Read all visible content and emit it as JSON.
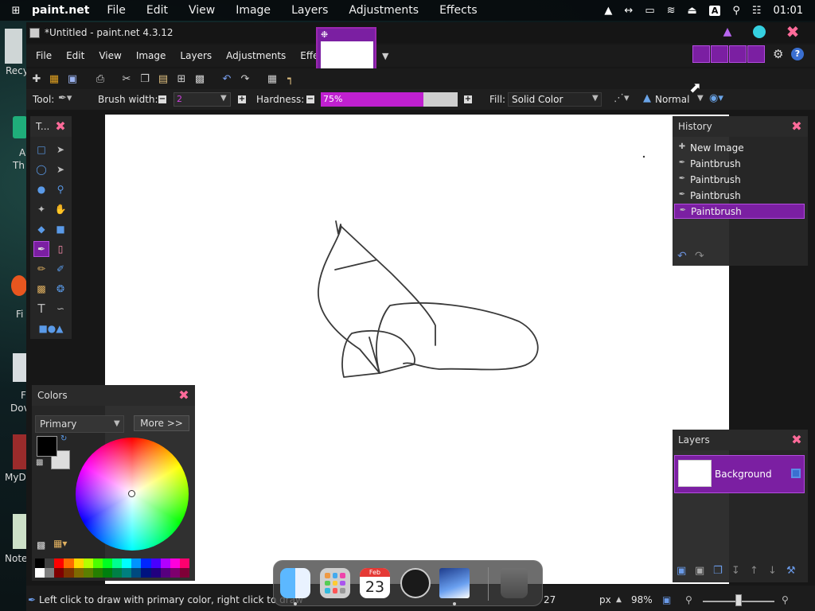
{
  "os_menubar": {
    "app_name": "paint.net",
    "menus": [
      "File",
      "Edit",
      "View",
      "Image",
      "Layers",
      "Adjustments",
      "Effects"
    ],
    "clock": "01:01",
    "input_indicator": "A"
  },
  "desktop_labels": [
    "Recy",
    "A",
    "Th",
    "Fi",
    "F",
    "Dov",
    "MyD",
    "Note"
  ],
  "window": {
    "title": "*Untitled - paint.net 4.3.12",
    "menus": [
      "File",
      "Edit",
      "View",
      "Image",
      "Layers",
      "Adjustments",
      "Effects"
    ]
  },
  "toolbar": {
    "tool_label": "Tool:",
    "brush_width_label": "Brush width:",
    "brush_width_value": "2",
    "hardness_label": "Hardness:",
    "hardness_value": "75%",
    "hardness_fraction": 0.75,
    "fill_label": "Fill:",
    "fill_value": "Solid Color",
    "blend_mode": "Normal"
  },
  "tools_panel": {
    "title": "T..."
  },
  "history": {
    "title": "History",
    "items": [
      {
        "label": "New Image",
        "icon": "new-image-icon"
      },
      {
        "label": "Paintbrush",
        "icon": "paintbrush-icon"
      },
      {
        "label": "Paintbrush",
        "icon": "paintbrush-icon"
      },
      {
        "label": "Paintbrush",
        "icon": "paintbrush-icon"
      },
      {
        "label": "Paintbrush",
        "icon": "paintbrush-icon",
        "selected": true
      }
    ]
  },
  "colors_panel": {
    "title": "Colors",
    "select_value": "Primary",
    "more_button": "More >>",
    "primary_color": "#000000",
    "secondary_color": "#dddddd"
  },
  "layers_panel": {
    "title": "Layers",
    "layers": [
      {
        "name": "Background",
        "visible": true,
        "selected": true
      }
    ]
  },
  "status": {
    "hint": "Left click to draw with primary color, right click to draw",
    "coord_fragment": "27",
    "unit": "px",
    "zoom": "98%"
  },
  "dock": {
    "calendar_month": "Feb",
    "calendar_day": "23"
  },
  "colors": {
    "accent": "#7b1fa2",
    "accent_border": "#b44ce0",
    "close_pink": "#ff6b9a"
  }
}
